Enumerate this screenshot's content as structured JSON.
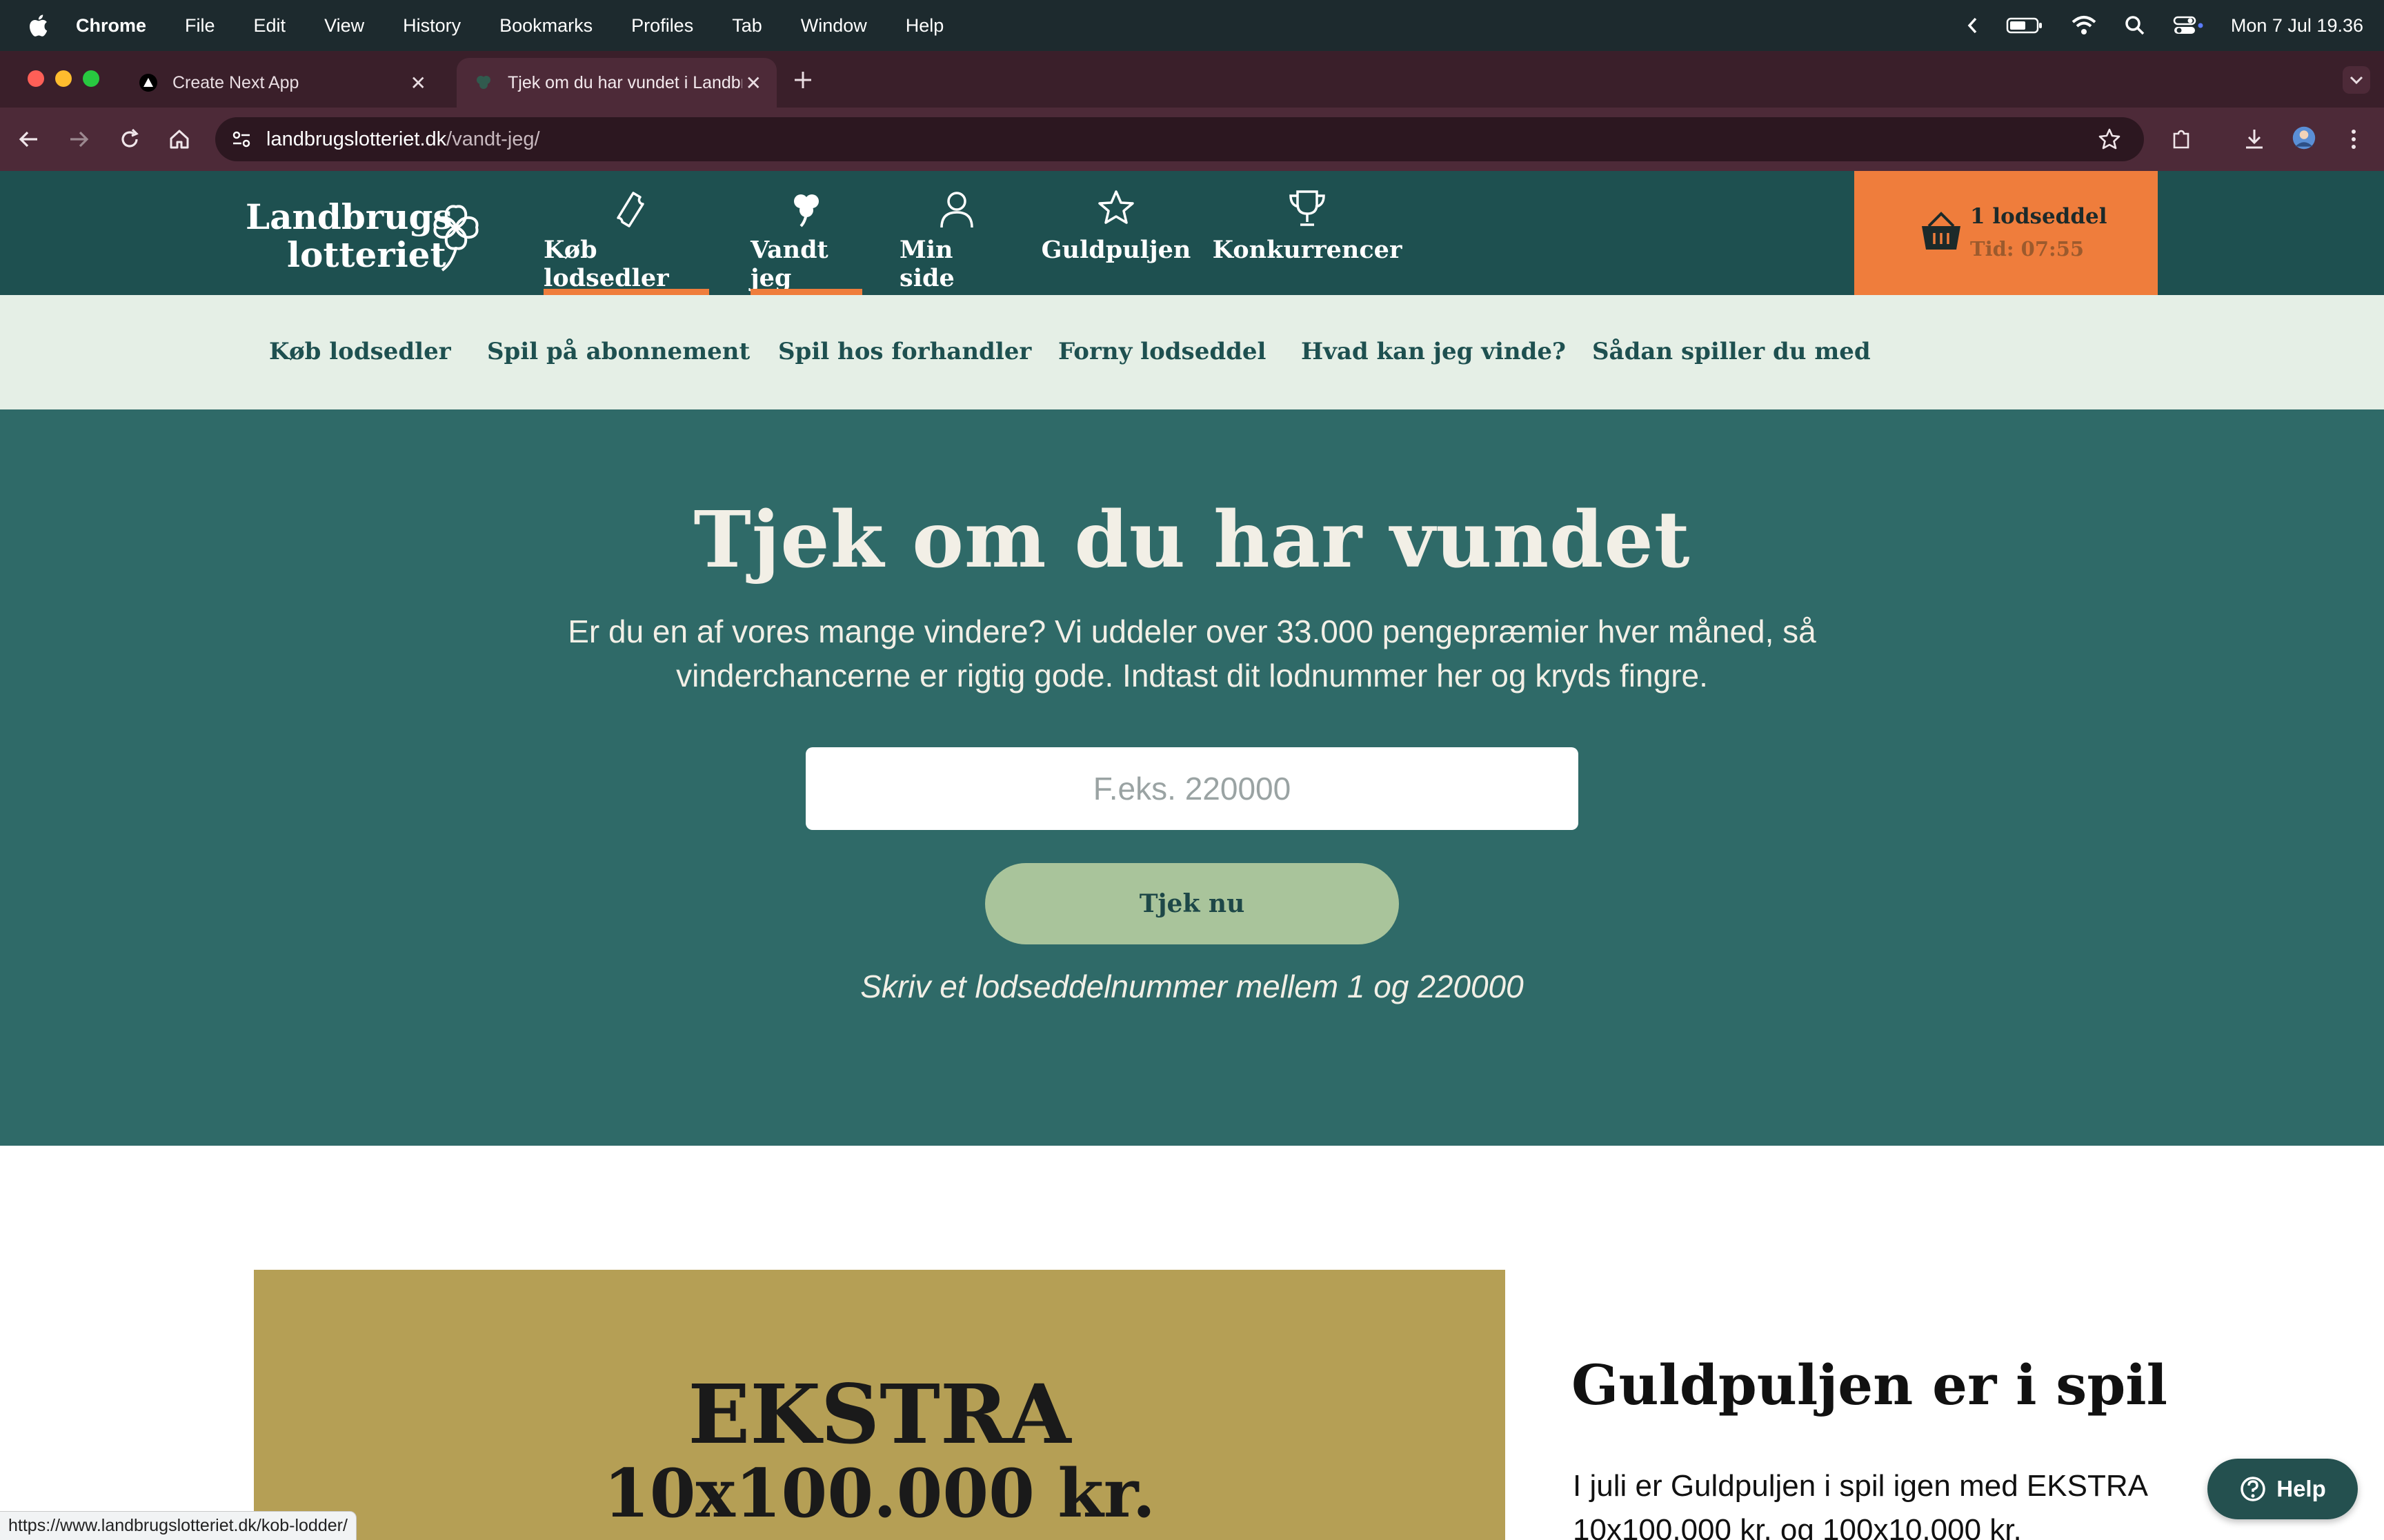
{
  "os_menubar": {
    "app_name": "Chrome",
    "menus": [
      "File",
      "Edit",
      "View",
      "History",
      "Bookmarks",
      "Profiles",
      "Tab",
      "Window",
      "Help"
    ],
    "clock": "Mon 7 Jul  19.36"
  },
  "browser": {
    "tabs": [
      {
        "label": "Create Next App",
        "icon": "nextjs-favicon",
        "active": false
      },
      {
        "label": "Tjek om du har vundet i Landbrugslotteriet",
        "icon": "clover-favicon",
        "active": true
      }
    ],
    "url_host": "landbrugslotteriet.dk",
    "url_path": "/vandt-jeg/",
    "status_url": "https://www.landbrugslotteriet.dk/kob-lodder/"
  },
  "site": {
    "logo": {
      "line1": "Landbrugs",
      "line2": "lotteriet"
    },
    "main_nav": [
      {
        "label": "Køb lodsedler",
        "icon": "ticket-icon",
        "underlined": true
      },
      {
        "label": "Vandt jeg",
        "icon": "clover-icon",
        "underlined": true
      },
      {
        "label": "Min side",
        "icon": "user-icon",
        "underlined": false
      },
      {
        "label": "Guldpuljen",
        "icon": "star-icon",
        "underlined": false
      },
      {
        "label": "Konkurrencer",
        "icon": "trophy-icon",
        "underlined": false
      }
    ],
    "cart": {
      "title": "1 lodseddel",
      "time": "Tid: 07:55"
    },
    "sub_nav": [
      "Køb lodsedler",
      "Spil på abonnement",
      "Spil hos forhandler",
      "Forny lodseddel",
      "Hvad kan jeg vinde?",
      "Sådan spiller du med"
    ]
  },
  "hero": {
    "title": "Tjek om du har vundet",
    "description": "Er du en af vores mange vindere? Vi uddeler over 33.000 pengepræmier hver måned, så vinderchancerne er rigtig gode. Indtast dit lodnummer her og kryds fingre.",
    "input_placeholder": "F.eks. 220000",
    "button_label": "Tjek nu",
    "hint": "Skriv et lodseddelnummer mellem 1 og 220000"
  },
  "promo": {
    "line1": "EKSTRA",
    "line2": "10x100.000 kr.",
    "section_title": "Guldpuljen er i spil",
    "section_text": "I juli er Guldpuljen i spil igen med EKSTRA 10x100.000 kr. og 100x10.000 kr."
  },
  "help": {
    "label": "Help"
  },
  "colors": {
    "header_bg": "#1e5050",
    "hero_bg": "#2f6a68",
    "accent_orange": "#ef7d3c",
    "subnav_bg": "#e5efe6",
    "button_green": "#a9c49b",
    "promo_gold": "#b59f55"
  }
}
